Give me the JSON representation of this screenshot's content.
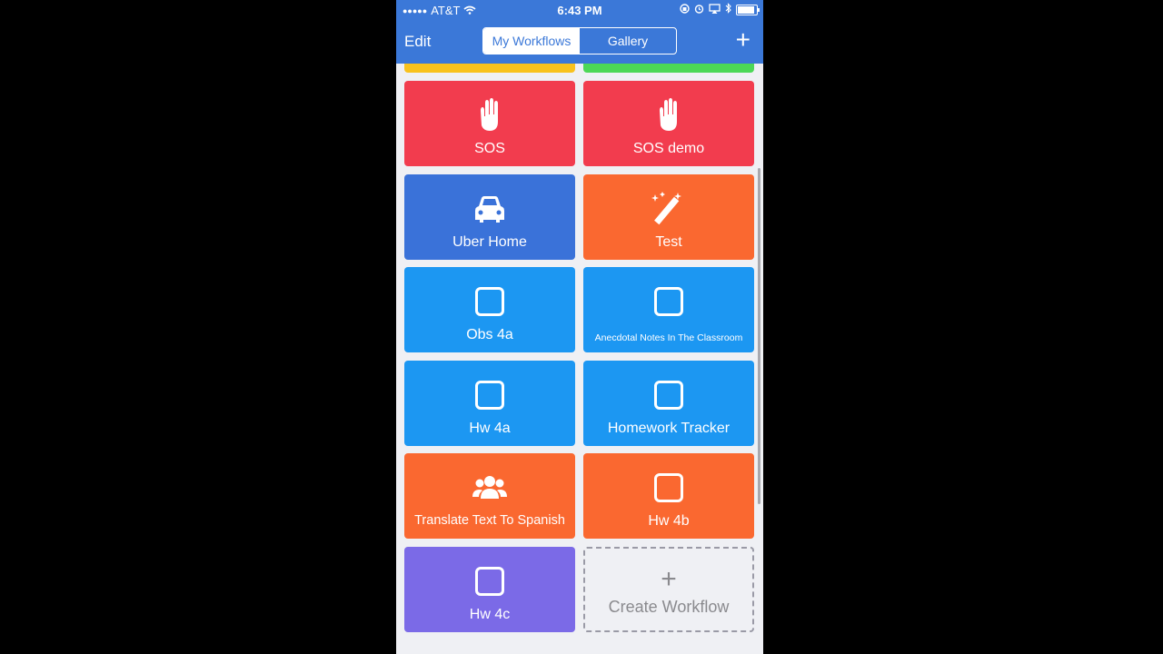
{
  "status_bar": {
    "carrier": "AT&T",
    "time": "6:43 PM"
  },
  "nav": {
    "edit_label": "Edit",
    "tabs": [
      {
        "label": "My Workflows",
        "active": true
      },
      {
        "label": "Gallery",
        "active": false
      }
    ],
    "add_label": "+"
  },
  "workflows": [
    {
      "label": "SOS",
      "icon": "hand-icon",
      "color": "#f23c4e"
    },
    {
      "label": "SOS demo",
      "icon": "hand-icon",
      "color": "#f23c4e"
    },
    {
      "label": "Uber Home",
      "icon": "car-icon",
      "color": "#3a72d9"
    },
    {
      "label": "Test",
      "icon": "magic-wand-icon",
      "color": "#fa6830"
    },
    {
      "label": "Obs 4a",
      "icon": "square-icon",
      "color": "#1c97f2"
    },
    {
      "label": "Anecdotal Notes In The Classroom",
      "icon": "square-icon",
      "color": "#1c97f2"
    },
    {
      "label": "Hw 4a",
      "icon": "square-icon",
      "color": "#1c97f2"
    },
    {
      "label": "Homework Tracker",
      "icon": "square-icon",
      "color": "#1c97f2"
    },
    {
      "label": "Translate Text To Spanish",
      "icon": "people-icon",
      "color": "#fa6830"
    },
    {
      "label": "Hw 4b",
      "icon": "square-icon",
      "color": "#fa6830"
    },
    {
      "label": "Hw 4c",
      "icon": "square-icon",
      "color": "#7b6ae7"
    }
  ],
  "create_tile": {
    "icon": "+",
    "label": "Create Workflow"
  }
}
